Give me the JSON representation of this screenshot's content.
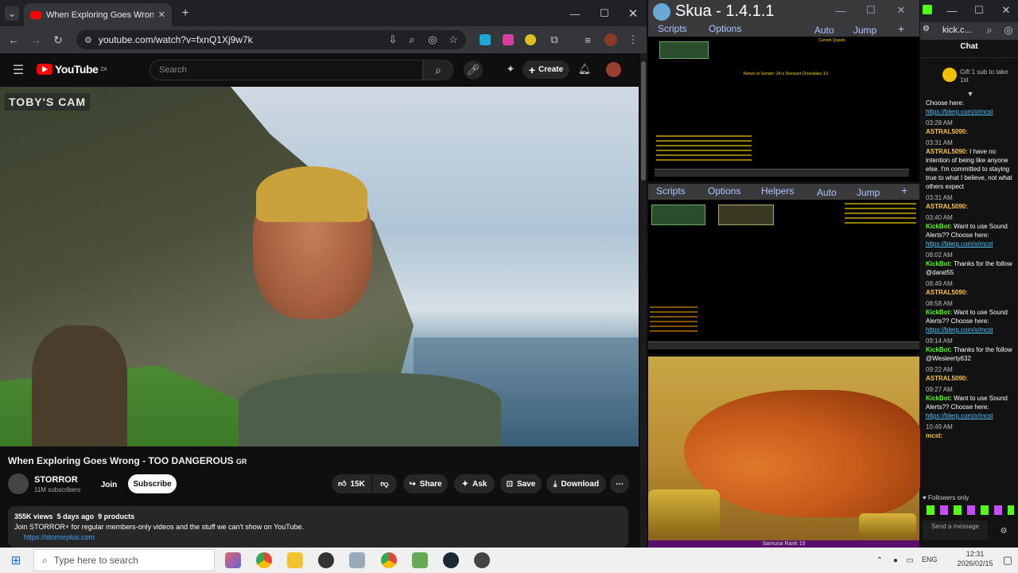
{
  "browser": {
    "tab_title": "When Exploring Goes Wrong - TOO DANGEROUS",
    "url": "youtube.com/watch?v=fxnQ1Xj9w7k"
  },
  "youtube": {
    "logo": "YouTube",
    "region": "ZA",
    "search_placeholder": "Search",
    "create_label": "Create",
    "cam_label": "TOBY'S CAM",
    "video_title": "When Exploring Goes Wrong - TOO DANGEROUS",
    "title_suffix": "GR",
    "channel": "STORROR",
    "subscribers": "11M subscribers",
    "join_label": "Join",
    "subscribe_label": "Subscribe",
    "likes": "15K",
    "share_label": "Share",
    "ask_label": "Ask",
    "save_label": "Save",
    "download_label": "Download",
    "views": "355K views",
    "age": "5 days ago",
    "products": "9 products",
    "desc_line1": "Join STORROR+ for regular members-only videos and the stuff we can't show on YouTube.",
    "desc_link": "https://storrorplus.com"
  },
  "skua": {
    "title": "Skua - 1.4.1.1",
    "menu1": [
      "Scripts",
      "Options",
      "Auto",
      "Jump"
    ],
    "menu2": [
      "Scripts",
      "Options",
      "Helpers",
      "Auto",
      "Jump"
    ],
    "quest_header": "Current Quests",
    "return_text": "Return to Sender: Zin's Discount Chocolates 1/1",
    "rank_label": "Samurai Rank 15"
  },
  "kick": {
    "url": "kick.c...",
    "chat_label": "Chat",
    "gift_text": "Gift 1 sub to take 1st",
    "followers_only": "Followers only",
    "send_placeholder": "Send a message",
    "messages": [
      {
        "time": "",
        "user": "",
        "text": "Choose here:",
        "link": "https://blerp.com/x/mcst"
      },
      {
        "time": "03:28 AM",
        "user": "ASTRAL5090:",
        "text": "",
        "link": ""
      },
      {
        "time": "03:31 AM",
        "user": "ASTRAL5090:",
        "text": "I have no intention of being like anyone else. I'm committed to staying true to what I believe, not what others expect",
        "link": ""
      },
      {
        "time": "03:31 AM",
        "user": "ASTRAL5090:",
        "text": "",
        "link": ""
      },
      {
        "time": "03:40 AM",
        "user": "KickBot:",
        "text": "Want to use Sound Alerts?? Choose here:",
        "link": "https://blerp.com/x/mcst"
      },
      {
        "time": "08:02 AM",
        "user": "KickBot:",
        "text": "Thanks for the follow @darat55",
        "link": ""
      },
      {
        "time": "08:49 AM",
        "user": "ASTRAL5090:",
        "text": "",
        "link": ""
      },
      {
        "time": "08:58 AM",
        "user": "KickBot:",
        "text": "Want to use Sound Alerts?? Choose here:",
        "link": "https://blerp.com/x/mcst"
      },
      {
        "time": "09:14 AM",
        "user": "KickBot:",
        "text": "Thanks for the follow @Wesieerty632",
        "link": ""
      },
      {
        "time": "09:22 AM",
        "user": "ASTRAL5090:",
        "text": "",
        "link": ""
      },
      {
        "time": "09:27 AM",
        "user": "KickBot:",
        "text": "Want to use Sound Alerts?? Choose here:",
        "link": "https://blerp.com/x/mcst"
      },
      {
        "time": "10:49 AM",
        "user": "mcst:",
        "text": "",
        "link": ""
      }
    ]
  },
  "taskbar": {
    "search_placeholder": "Type here to search",
    "lang": "ENG",
    "time": "12:31",
    "date": "2026/02/15"
  },
  "colors": {
    "yt_red": "#ff0000",
    "kick_green": "#53fc18",
    "skua_link": "#aac7ff"
  }
}
